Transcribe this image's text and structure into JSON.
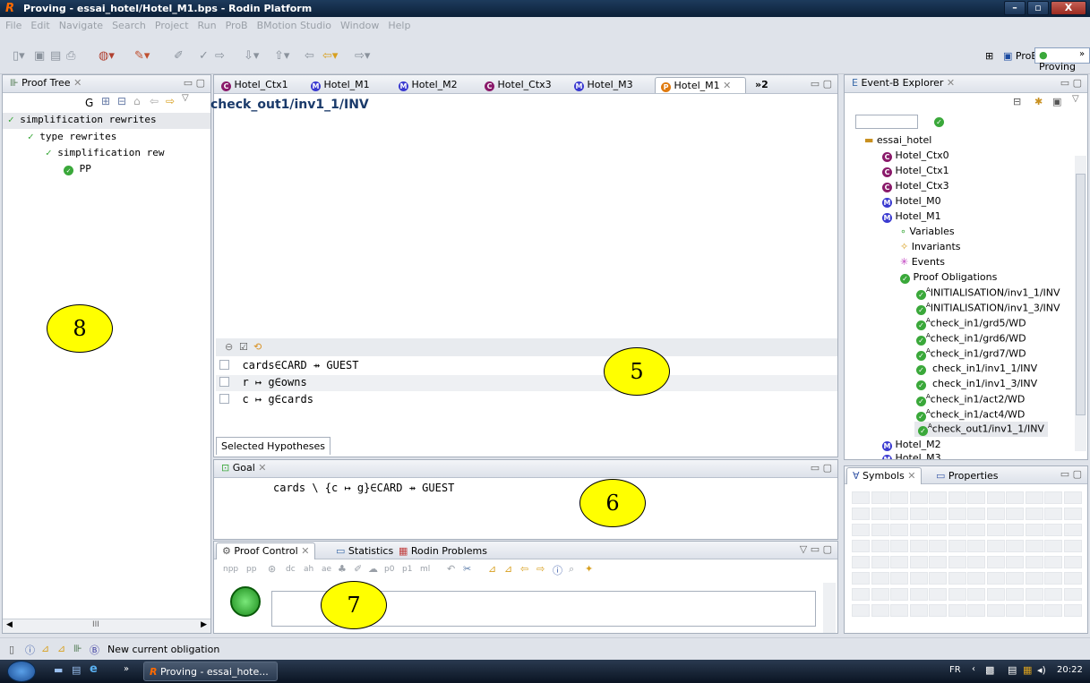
{
  "window": {
    "title": "Proving - essai_hotel/Hotel_M1.bps - Rodin Platform",
    "app_icon": "R"
  },
  "menu": [
    "File",
    "Edit",
    "Navigate",
    "Search",
    "Project",
    "Run",
    "ProB",
    "BMotion Studio",
    "Window",
    "Help"
  ],
  "perspectives": {
    "prob": "ProB",
    "proving": "Proving",
    "more": "»"
  },
  "proof_tree": {
    "title": "Proof Tree",
    "toolbar_g": "G",
    "nodes": [
      {
        "label": "simplification rewrites"
      },
      {
        "label": "type rewrites"
      },
      {
        "label": "simplification rew"
      },
      {
        "label": "PP"
      }
    ],
    "hscroll": "III"
  },
  "editor_tabs": [
    {
      "label": "Hotel_Ctx1",
      "kind": "C"
    },
    {
      "label": "Hotel_M1",
      "kind": "M"
    },
    {
      "label": "Hotel_M2",
      "kind": "M"
    },
    {
      "label": "Hotel_Ctx3",
      "kind": "C"
    },
    {
      "label": "Hotel_M3",
      "kind": "M"
    },
    {
      "label": "Hotel_M1",
      "kind": "P"
    }
  ],
  "editor_overflow": "»2",
  "proof_editor": {
    "obligation": "check_out1/inv1_1/INV",
    "hypotheses": [
      "cards∈CARD ⇸ GUEST",
      "r ↦ g∈owns",
      "c ↦ g∈cards"
    ],
    "hyp_tab": "Selected Hypotheses"
  },
  "goal": {
    "title": "Goal",
    "text": "cards \\ {c ↦ g}∈CARD ⇸ GUEST"
  },
  "proof_control": {
    "tabs": [
      "Proof Control",
      "Statistics",
      "Rodin Problems"
    ],
    "buttons": [
      "npp",
      "pp",
      "dc",
      "ah",
      "ae",
      "p0",
      "p1",
      "ml"
    ]
  },
  "explorer": {
    "title": "Event-B Explorer",
    "project": "essai_hotel",
    "items": [
      {
        "label": "Hotel_Ctx0",
        "kind": "C"
      },
      {
        "label": "Hotel_Ctx1",
        "kind": "C"
      },
      {
        "label": "Hotel_Ctx3",
        "kind": "C"
      },
      {
        "label": "Hotel_M0",
        "kind": "M"
      },
      {
        "label": "Hotel_M1",
        "kind": "M"
      }
    ],
    "m1_children": [
      "Variables",
      "Invariants",
      "Events",
      "Proof Obligations"
    ],
    "pos": [
      {
        "label": "INITIALISATION/inv1_1/INV",
        "auto": true
      },
      {
        "label": "INITIALISATION/inv1_3/INV",
        "auto": true
      },
      {
        "label": "check_in1/grd5/WD",
        "auto": true
      },
      {
        "label": "check_in1/grd6/WD",
        "auto": true
      },
      {
        "label": "check_in1/grd7/WD",
        "auto": true
      },
      {
        "label": "check_in1/inv1_1/INV",
        "auto": false
      },
      {
        "label": "check_in1/inv1_3/INV",
        "auto": false
      },
      {
        "label": "check_in1/act2/WD",
        "auto": true
      },
      {
        "label": "check_in1/act4/WD",
        "auto": true
      },
      {
        "label": "check_out1/inv1_1/INV",
        "auto": true
      }
    ],
    "after": [
      {
        "label": "Hotel_M2",
        "kind": "M"
      },
      {
        "label": "Hotel_M3",
        "kind": "M"
      }
    ]
  },
  "symbols": {
    "tabs": [
      "Symbols",
      "Properties"
    ]
  },
  "status": {
    "message": "New current obligation"
  },
  "taskbar": {
    "task": "Proving - essai_hote...",
    "lang": "FR",
    "time": "20:22"
  },
  "annotations": [
    "8",
    "5",
    "6",
    "7"
  ]
}
